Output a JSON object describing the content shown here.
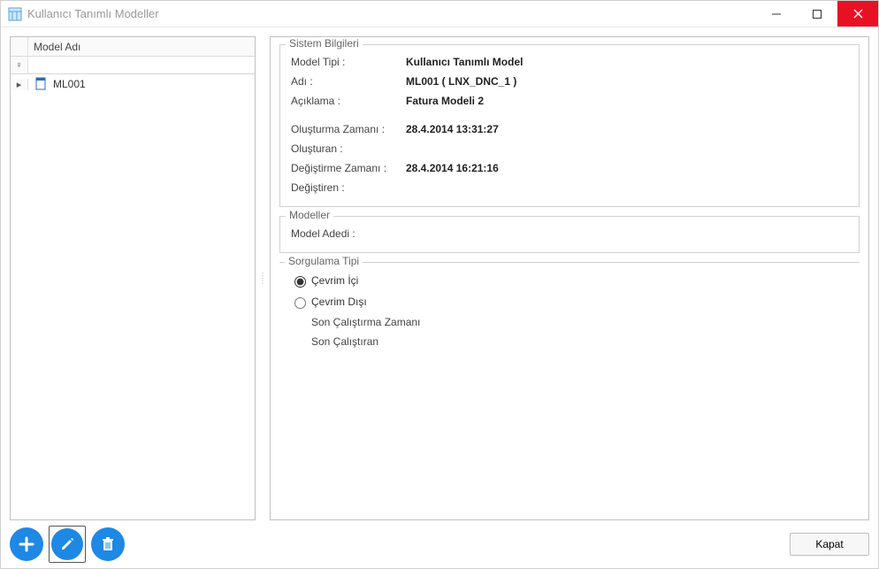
{
  "window": {
    "title": "Kullanıcı Tanımlı Modeller"
  },
  "grid": {
    "header": "Model Adı",
    "filter_indicator": "♀",
    "row_indicator": "▸",
    "rows": [
      {
        "name": "ML001"
      }
    ]
  },
  "system_info": {
    "legend": "Sistem Bilgileri",
    "model_type_label": "Model Tipi :",
    "model_type_value": "Kullanıcı Tanımlı Model",
    "name_label": "Adı :",
    "name_value": "ML001 ( LNX_DNC_1 )",
    "desc_label": "Açıklama :",
    "desc_value": "Fatura Modeli 2",
    "created_label": "Oluşturma Zamanı :",
    "created_value": "28.4.2014 13:31:27",
    "creator_label": "Oluşturan :",
    "creator_value": "",
    "modified_label": "Değiştirme Zamanı :",
    "modified_value": "28.4.2014 16:21:16",
    "modifier_label": "Değiştiren :",
    "modifier_value": ""
  },
  "models": {
    "legend": "Modeller",
    "count_label": "Model Adedi :",
    "count_value": ""
  },
  "query_type": {
    "legend": "Sorgulama Tipi",
    "online_label": "Çevrim İçi",
    "offline_label": "Çevrim Dışı",
    "selected": "online",
    "last_run_time_label": "Son Çalıştırma Zamanı",
    "last_runner_label": "Son Çalıştıran"
  },
  "footer": {
    "close_label": "Kapat"
  }
}
